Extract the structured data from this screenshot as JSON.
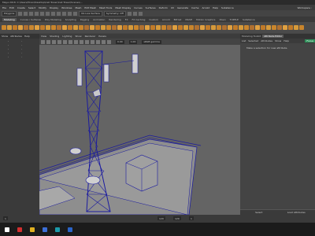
{
  "title_bar": {
    "text": "Maya 2018: C:\\Users\\Hiren\\Desktop\\Cell Tower\\Cell Tower\\Scenes\\..."
  },
  "menu_bar": {
    "items": [
      "File",
      "Edit",
      "Create",
      "Select",
      "Modify",
      "Display",
      "Windows",
      "Mesh",
      "Edit Mesh",
      "Mesh Tools",
      "Mesh Display",
      "Curves",
      "Surfaces",
      "Deform",
      "UV",
      "Generate",
      "Cache",
      "Arnold",
      "Help",
      "Substance"
    ]
  },
  "menu_right": {
    "workspace": "Workspace :"
  },
  "status_line": {
    "mode_menu": "Polygons",
    "live_surface": "No Live Surface",
    "symmetry": "Symmetry: Off"
  },
  "shelf_tabs": {
    "active": "Modeling",
    "items": [
      "Curves / Surfaces",
      "Poly Modeling",
      "Sculpting",
      "Rigging",
      "Animation",
      "Rendering",
      "FX",
      "FX Caching",
      "Custom",
      "Arnold",
      "Bifrost",
      "MASH",
      "Motion Graphics",
      "XGen",
      "TURTLE",
      "Substance"
    ]
  },
  "colors": {
    "accent_focus": "#2f8f5a",
    "wireframe": "#1a1aa0"
  },
  "outliner": {
    "tabs": [
      "Show",
      "Attributes",
      "Help"
    ],
    "rows": [
      [
        "-",
        "-"
      ],
      [
        "-",
        "-"
      ],
      [
        "-",
        "-"
      ],
      [
        "-",
        "-"
      ],
      [
        "-",
        "-"
      ]
    ]
  },
  "viewport": {
    "menu": [
      "View",
      "Shading",
      "Lighting",
      "Show",
      "Renderer",
      "Panels"
    ],
    "camera_field": "sRGB gamma",
    "field_value_1": "0.00",
    "field_value_2": "1.00"
  },
  "attribute_editor": {
    "tabs": [
      "Modeling Toolkit",
      "Attribute Editor"
    ],
    "active_tab": "Attribute Editor",
    "sub": [
      "List",
      "Selected",
      "Focus",
      "Attributes",
      "Show",
      "Help"
    ],
    "focus_button": "Focus",
    "message": "Make a selection for new attribute.",
    "bottom_buttons": [
      "Select",
      "Load Attributes"
    ]
  },
  "timeline": {
    "start": "1",
    "end": "120",
    "frame": "1",
    "range_value": "120"
  },
  "taskbar": {
    "icons": [
      "start-icon",
      "search-icon",
      "chrome-icon",
      "explorer-icon",
      "maya-icon",
      "photoshop-icon"
    ]
  }
}
